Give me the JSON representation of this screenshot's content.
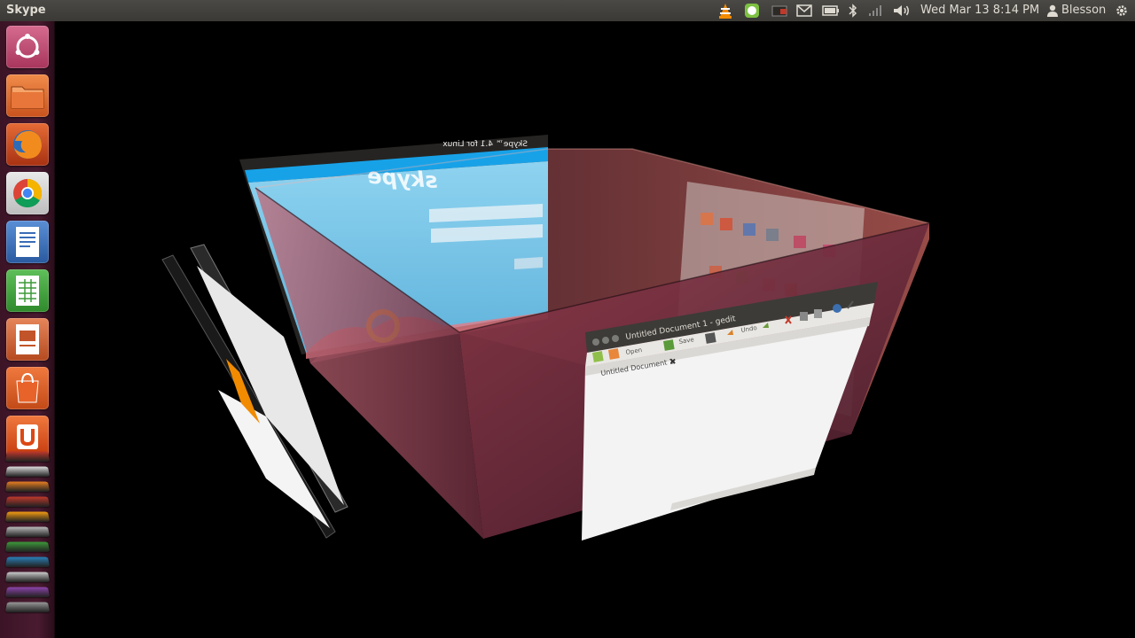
{
  "top_panel": {
    "app_title": "Skype",
    "clock": "Wed Mar 13  8:14 PM",
    "user": "Blesson"
  },
  "launcher": {
    "items": [
      {
        "name": "dash-home",
        "icon": "ubuntu-logo-icon",
        "color": "#c6466f"
      },
      {
        "name": "files",
        "icon": "folder-icon",
        "color": "#e8763a"
      },
      {
        "name": "firefox",
        "icon": "firefox-icon",
        "color": "#d24a1d"
      },
      {
        "name": "chrome",
        "icon": "chrome-icon",
        "color": "#4a8f3b"
      },
      {
        "name": "writer",
        "icon": "libreoffice-writer-icon",
        "color": "#3a6cb5"
      },
      {
        "name": "calc",
        "icon": "libreoffice-calc-icon",
        "color": "#3d9a3a"
      },
      {
        "name": "impress",
        "icon": "libreoffice-impress-icon",
        "color": "#c2542a"
      },
      {
        "name": "software-center",
        "icon": "shopping-bag-icon",
        "color": "#d7572a"
      },
      {
        "name": "ubuntu-one",
        "icon": "ubuntu-one-icon",
        "color": "#dd4814"
      }
    ],
    "stack_colors": [
      "#c0392b",
      "#ddd",
      "#e67e22",
      "#c0392b",
      "#f39c12",
      "#bbb",
      "#3d9a3a",
      "#2980b9",
      "#ccc",
      "#8e44ad",
      "#999"
    ]
  },
  "skype_window": {
    "title": "Skype™ 4.1 for Linux",
    "logo": "skype"
  },
  "gedit_window": {
    "title": "Untitled Document 1 - gedit",
    "toolbar_open": "Open",
    "toolbar_save": "Save",
    "toolbar_undo": "Undo",
    "tab_label": "Untitled Document 1"
  }
}
